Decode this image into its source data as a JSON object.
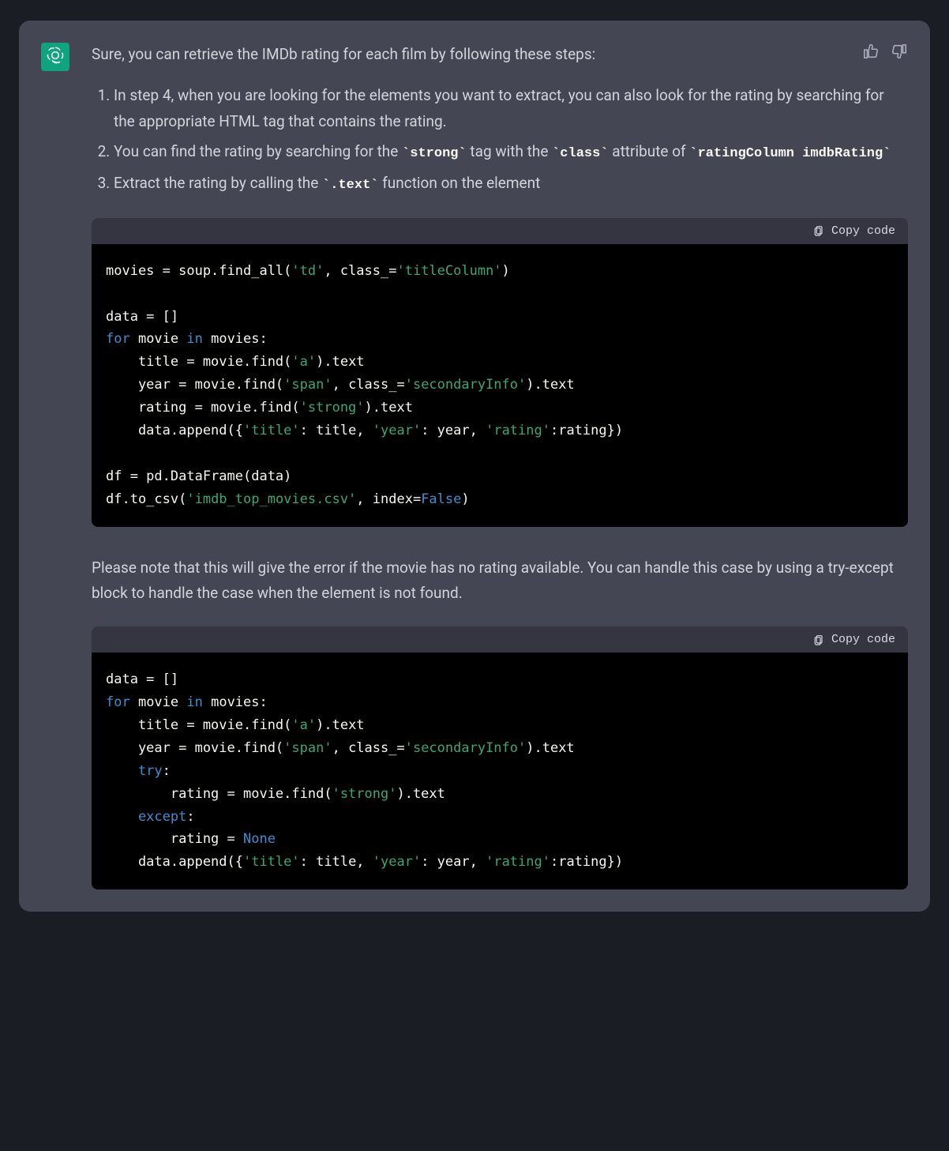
{
  "intro": "Sure, you can retrieve the IMDb rating for each film by following these steps:",
  "steps": [
    {
      "pre": "In step 4, when you are looking for the elements you want to extract, you can also look for the rating by searching for the appropriate HTML tag that contains the rating."
    },
    {
      "pre": "You can find the rating by searching for the ",
      "code1": "`strong`",
      "mid1": " tag with the ",
      "code2": "`class`",
      "mid2": " attribute of ",
      "code3": "`ratingColumn imdbRating`"
    },
    {
      "pre": "Extract the rating by calling the ",
      "code1": "`.text`",
      "mid1": " function on the element"
    }
  ],
  "copy_label": "Copy code",
  "note_paragraph": "Please note that this will give the error if the movie has no rating available. You can handle this case by using a try-except block to handle the case when the element is not found.",
  "code1": {
    "l1a": "movies = soup.find_all(",
    "l1s1": "'td'",
    "l1b": ", class_=",
    "l1s2": "'titleColumn'",
    "l1c": ")",
    "l3": "data = []",
    "l4a": "for",
    "l4b": " movie ",
    "l4c": "in",
    "l4d": " movies:",
    "l5a": "    title = movie.find(",
    "l5s1": "'a'",
    "l5b": ").text",
    "l6a": "    year = movie.find(",
    "l6s1": "'span'",
    "l6b": ", class_=",
    "l6s2": "'secondaryInfo'",
    "l6c": ").text",
    "l7a": "    rating = movie.find(",
    "l7s1": "'strong'",
    "l7b": ").text",
    "l8a": "    data.append({",
    "l8s1": "'title'",
    "l8b": ": title, ",
    "l8s2": "'year'",
    "l8c": ": year, ",
    "l8s3": "'rating'",
    "l8d": ":rating})",
    "l10": "df = pd.DataFrame(data)",
    "l11a": "df.to_csv(",
    "l11s1": "'imdb_top_movies.csv'",
    "l11b": ", index=",
    "l11c": "False",
    "l11d": ")"
  },
  "code2": {
    "l1": "data = []",
    "l2a": "for",
    "l2b": " movie ",
    "l2c": "in",
    "l2d": " movies:",
    "l3a": "    title = movie.find(",
    "l3s1": "'a'",
    "l3b": ").text",
    "l4a": "    year = movie.find(",
    "l4s1": "'span'",
    "l4b": ", class_=",
    "l4s2": "'secondaryInfo'",
    "l4c": ").text",
    "l5a": "    try",
    "l5b": ":",
    "l6a": "        rating = movie.find(",
    "l6s1": "'strong'",
    "l6b": ").text",
    "l7a": "    except",
    "l7b": ":",
    "l8a": "        rating = ",
    "l8b": "None",
    "l9a": "    data.append({",
    "l9s1": "'title'",
    "l9b": ": title, ",
    "l9s2": "'year'",
    "l9c": ": year, ",
    "l9s3": "'rating'",
    "l9d": ":rating})"
  }
}
